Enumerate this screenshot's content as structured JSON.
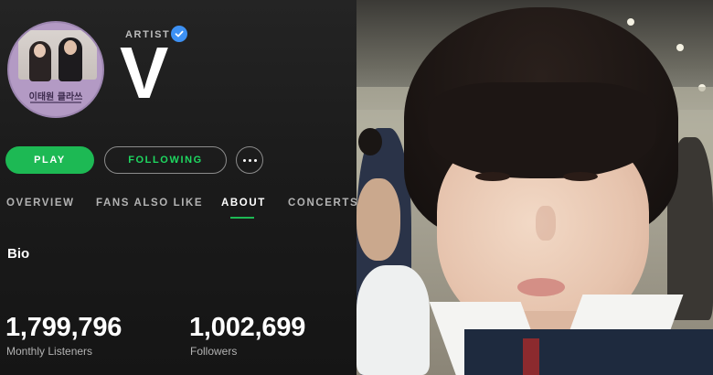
{
  "artist": {
    "label": "ARTIST",
    "name": "V",
    "verified": true,
    "verified_color": "#3d91f4",
    "avatar": {
      "album_text": "이태원 클라쓰"
    }
  },
  "actions": {
    "play_label": "PLAY",
    "following_label": "FOLLOWING",
    "more_icon": "more-horizontal-icon"
  },
  "tabs": [
    {
      "label": "OVERVIEW",
      "active": false
    },
    {
      "label": "FANS ALSO LIKE",
      "active": false
    },
    {
      "label": "ABOUT",
      "active": true
    },
    {
      "label": "CONCERTS",
      "active": false
    }
  ],
  "bio": {
    "title": "Bio"
  },
  "stats": [
    {
      "value": "1,799,796",
      "label": "Monthly Listeners"
    },
    {
      "value": "1,002,699",
      "label": "Followers"
    }
  ],
  "colors": {
    "accent_green": "#1db954",
    "following_text": "#1ed760",
    "background": "#121212"
  }
}
